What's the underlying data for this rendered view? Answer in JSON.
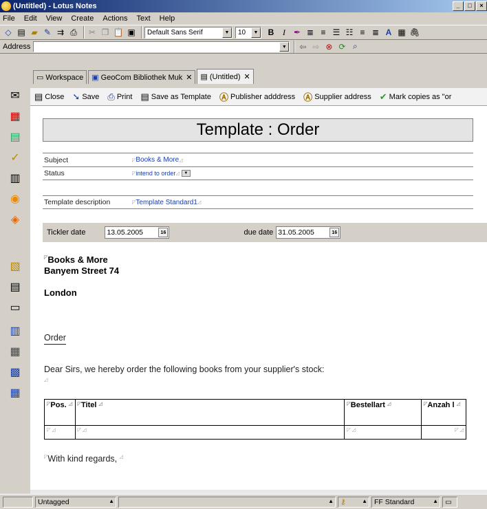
{
  "window": {
    "title": "(Untitled) - Lotus Notes"
  },
  "menu": [
    "File",
    "Edit",
    "View",
    "Create",
    "Actions",
    "Text",
    "Help"
  ],
  "toolbar": {
    "font": "Default Sans Serif",
    "size": "10"
  },
  "address": {
    "label": "Address",
    "value": ""
  },
  "tabs": [
    {
      "label": "Workspace"
    },
    {
      "label": "GeoCom Bibliothek Muk"
    },
    {
      "label": "(Untitled)"
    }
  ],
  "actions": [
    {
      "label": "Close"
    },
    {
      "label": "Save"
    },
    {
      "label": "Print"
    },
    {
      "label": "Save as Template"
    },
    {
      "label": "Publisher adddress"
    },
    {
      "label": "Supplier address"
    },
    {
      "label": "Mark copies as \"or"
    }
  ],
  "form": {
    "title": "Template : Order",
    "subject_label": "Subject",
    "subject_value": "Books & More",
    "status_label": "Status",
    "status_value": "intend to order",
    "template_label": "Template description",
    "template_value": "Template Standard1",
    "tickler_label": "Tickler date",
    "tickler_value": "13.05.2005",
    "due_label": "due date",
    "due_value": "31.05.2005",
    "cal_icon": "16",
    "address_line1": "Books & More",
    "address_line2": "Banyem Street 74",
    "address_line3": "London",
    "order_heading": "Order",
    "body_text": "Dear Sirs, we hereby order the following books from your supplier's stock:",
    "table_headers": [
      "Pos.",
      "Titel",
      "Bestellart",
      "Anzah l"
    ],
    "closing": "With kind regards,"
  },
  "statusbar": {
    "tag": "Untagged",
    "style": "FF Standard"
  }
}
